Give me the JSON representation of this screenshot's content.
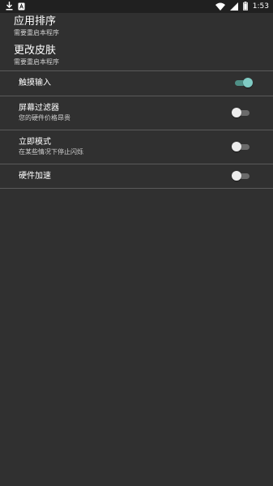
{
  "status_bar": {
    "time": "1:53",
    "left_icons": [
      "download-icon",
      "app-notification-icon"
    ],
    "right_icons": [
      "wifi-icon",
      "signal-icon",
      "battery-icon"
    ]
  },
  "headers": [
    {
      "title": "应用排序",
      "subtitle": "需要重启本程序"
    },
    {
      "title": "更改皮肤",
      "subtitle": "需要重启本程序"
    }
  ],
  "preferences": [
    {
      "title": "触摸输入",
      "subtitle": "",
      "checked": true
    },
    {
      "title": "屏幕过滤器",
      "subtitle": "您的硬件价格昂贵",
      "checked": false
    },
    {
      "title": "立即模式",
      "subtitle": "在某些情况下停止闪烁",
      "checked": false
    },
    {
      "title": "硬件加速",
      "subtitle": "",
      "checked": false
    }
  ],
  "colors": {
    "background": "#303030",
    "status_bar": "#202020",
    "divider": "#5a5a5a",
    "accent": "#80cbc4"
  }
}
